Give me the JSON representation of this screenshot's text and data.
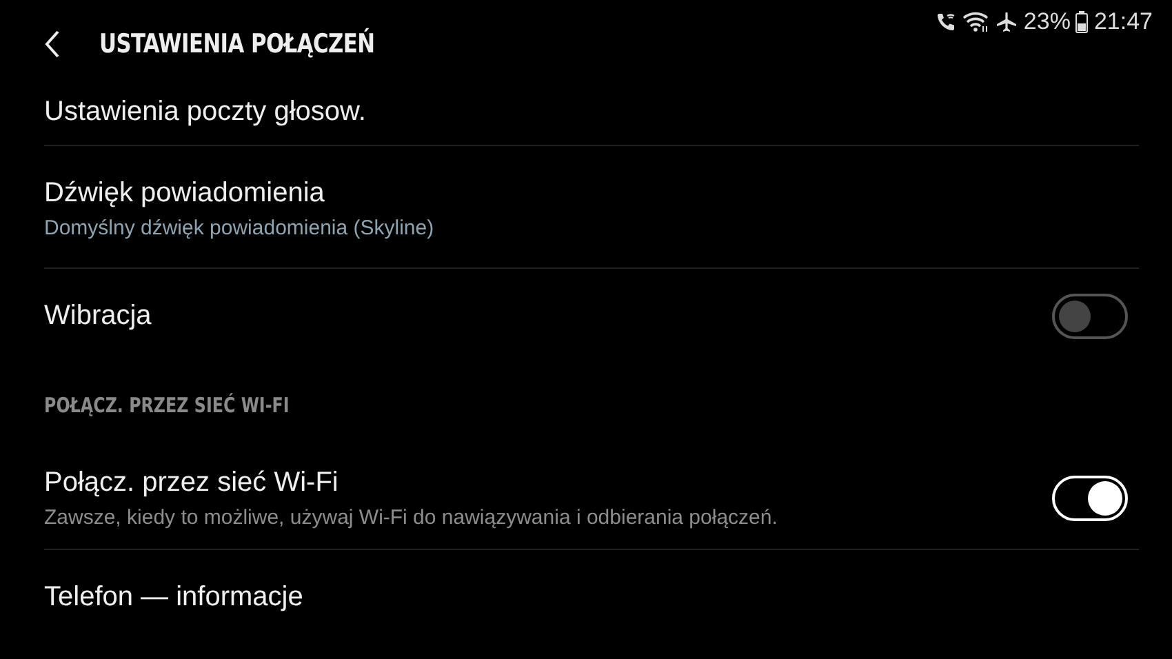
{
  "status_bar": {
    "battery": "23%",
    "time": "21:47"
  },
  "header": {
    "title": "USTAWIENIA POŁĄCZEŃ"
  },
  "items": [
    {
      "kind": "plain",
      "label": "Ustawienia poczty głosow."
    },
    {
      "kind": "value",
      "label": "Dźwięk powiadomienia",
      "summary": "Domyślny dźwięk powiadomienia (Skyline)"
    },
    {
      "kind": "switch",
      "label": "Wibracja",
      "on": false
    },
    {
      "kind": "section",
      "label": "POŁĄCZ. PRZEZ SIEĆ WI-FI"
    },
    {
      "kind": "switch",
      "label": "Połącz. przez sieć Wi-Fi",
      "summary": "Zawsze, kiedy to możliwe, używaj Wi-Fi do nawiązywania i odbierania połączeń.",
      "on": true
    },
    {
      "kind": "plain",
      "label": "Telefon — informacje"
    }
  ]
}
